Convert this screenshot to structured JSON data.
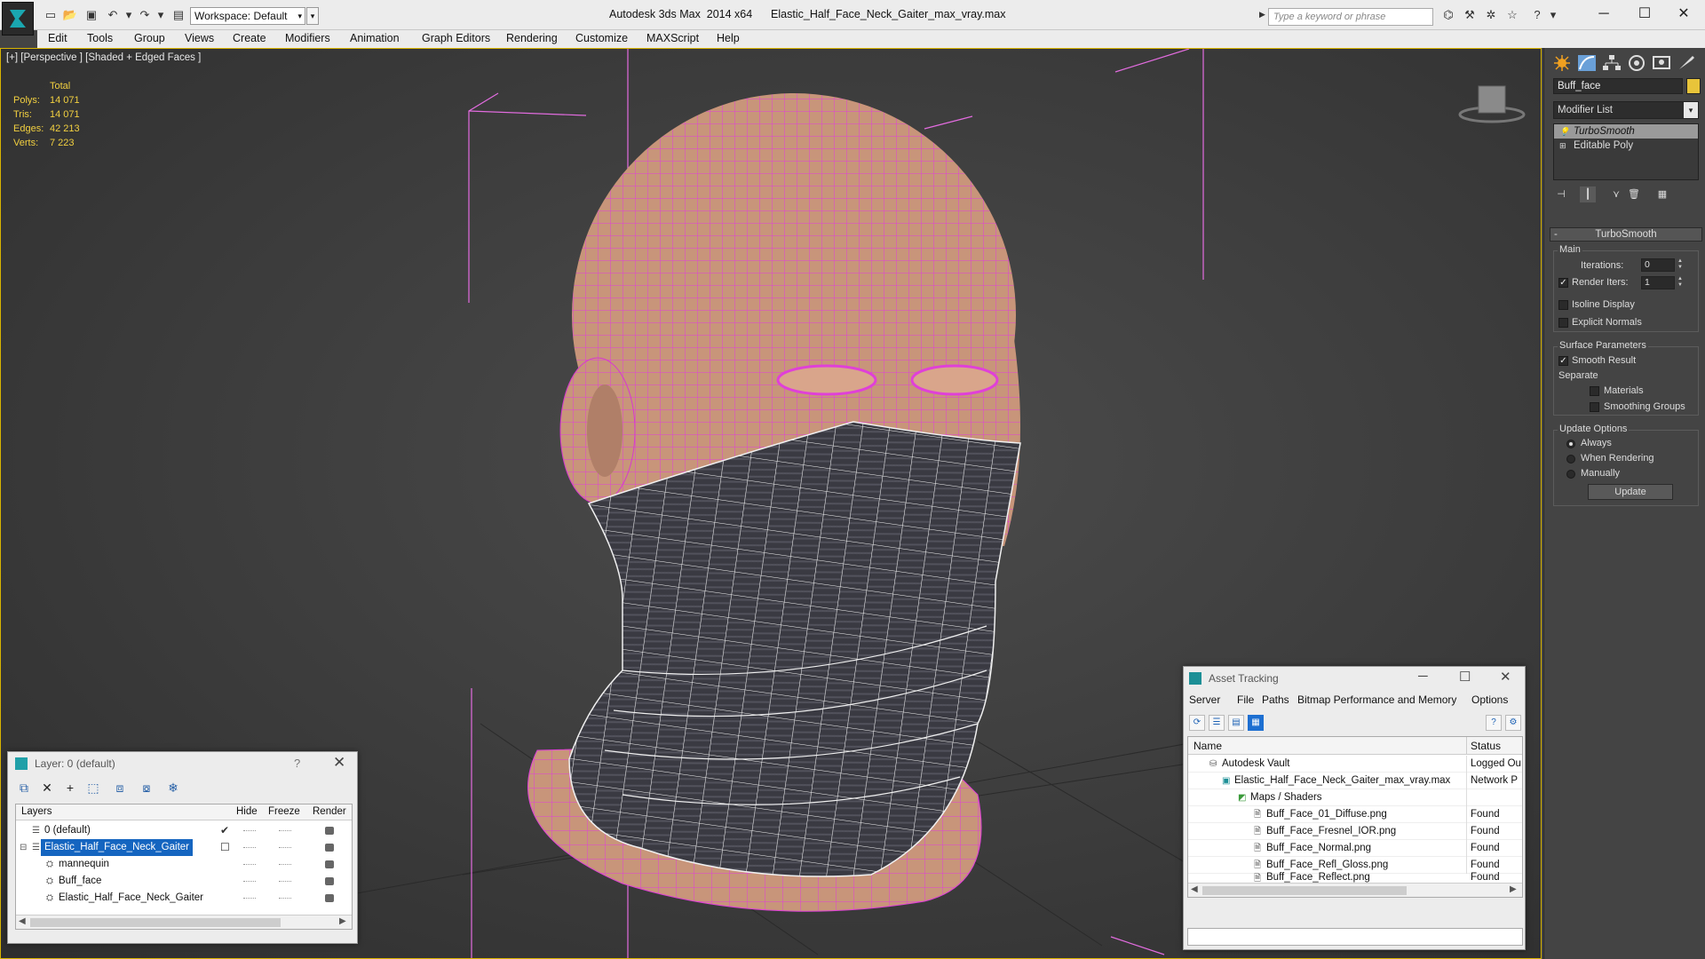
{
  "titlebar": {
    "workspace": "Workspace: Default",
    "app_title": "Autodesk 3ds Max  2014 x64      Elastic_Half_Face_Neck_Gaiter_max_vray.max",
    "search_placeholder": "Type a keyword or phrase",
    "minimize": "─",
    "maximize": "☐",
    "close": "✕"
  },
  "menu": [
    "Edit",
    "Tools",
    "Group",
    "Views",
    "Create",
    "Modifiers",
    "Animation",
    "Graph Editors",
    "Rendering",
    "Customize",
    "MAXScript",
    "Help"
  ],
  "viewport": {
    "label": "[+] [Perspective ] [Shaded + Edged Faces ]",
    "stats": {
      "header": "Total",
      "rows": [
        {
          "label": "Polys:",
          "value": "14 071"
        },
        {
          "label": "Tris:",
          "value": "14 071"
        },
        {
          "label": "Edges:",
          "value": "42 213"
        },
        {
          "label": "Verts:",
          "value": "7 223"
        }
      ]
    }
  },
  "command_panel": {
    "object_name": "Buff_face",
    "object_color": "#e8c43a",
    "modifier_list": "Modifier List",
    "stack": [
      "TurboSmooth",
      "Editable Poly"
    ],
    "rollout_title": "TurboSmooth",
    "main_group": "Main",
    "iterations_label": "Iterations:",
    "iterations_value": "0",
    "render_iters_label": "Render Iters:",
    "render_iters_value": "1",
    "isoline_label": "Isoline Display",
    "explicit_normals_label": "Explicit Normals",
    "surface_group": "Surface Parameters",
    "smooth_result_label": "Smooth Result",
    "separate_label": "Separate",
    "materials_label": "Materials",
    "smoothing_groups_label": "Smoothing Groups",
    "update_group": "Update Options",
    "always_label": "Always",
    "when_rendering_label": "When Rendering",
    "manually_label": "Manually",
    "update_button": "Update"
  },
  "layer_dialog": {
    "title": "Layer: 0 (default)",
    "help": "?",
    "close": "✕",
    "columns": [
      "Layers",
      "Hide",
      "Freeze",
      "Render"
    ],
    "rows": [
      {
        "name": "0 (default)",
        "indent": 0,
        "selected": false
      },
      {
        "name": "Elastic_Half_Face_Neck_Gaiter",
        "indent": 0,
        "selected": true
      },
      {
        "name": "mannequin",
        "indent": 1,
        "selected": false
      },
      {
        "name": "Buff_face",
        "indent": 1,
        "selected": false
      },
      {
        "name": "Elastic_Half_Face_Neck_Gaiter",
        "indent": 1,
        "selected": false
      }
    ]
  },
  "asset_tracking": {
    "title": "Asset Tracking",
    "menu": [
      "Server",
      "File",
      "Paths",
      "Bitmap Performance and Memory",
      "Options"
    ],
    "columns": [
      "Name",
      "Status"
    ],
    "rows": [
      {
        "name": "Autodesk Vault",
        "status": "Logged Ou",
        "indent": 1
      },
      {
        "name": "Elastic_Half_Face_Neck_Gaiter_max_vray.max",
        "status": "Network P",
        "indent": 2
      },
      {
        "name": "Maps / Shaders",
        "status": "",
        "indent": 3
      },
      {
        "name": "Buff_Face_01_Diffuse.png",
        "status": "Found",
        "indent": 4
      },
      {
        "name": "Buff_Face_Fresnel_IOR.png",
        "status": "Found",
        "indent": 4
      },
      {
        "name": "Buff_Face_Normal.png",
        "status": "Found",
        "indent": 4
      },
      {
        "name": "Buff_Face_Refl_Gloss.png",
        "status": "Found",
        "indent": 4
      },
      {
        "name": "Buff_Face_Reflect.png",
        "status": "Found",
        "indent": 4
      }
    ]
  },
  "colors": {
    "wire_pink": "#e040d8",
    "skin": "#c8957a",
    "fabric": "#3c3c44",
    "stats_text": "#f2d040",
    "viewport_border": "#d8b400"
  }
}
